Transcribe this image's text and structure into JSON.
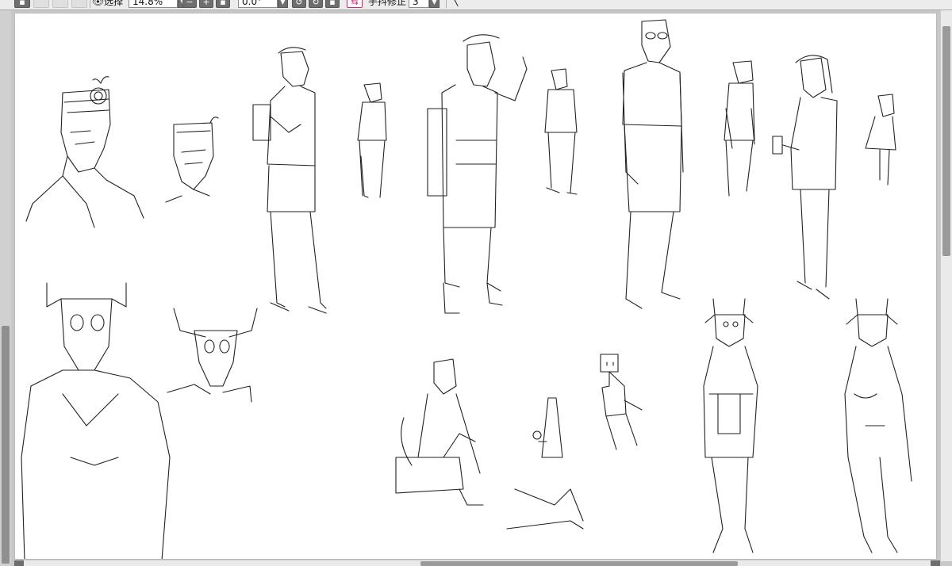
{
  "toolbar": {
    "view_mode_label": "选择",
    "zoom_value": "14.8%",
    "rotation_value": "0.0°",
    "stabilizer_label": "手抖修正",
    "stabilizer_value": "3",
    "icons": [
      "save-icon",
      "blank-icon",
      "undo-icon",
      "redo-icon",
      "eye-icon",
      "zoom-out-icon",
      "zoom-in-icon",
      "zoom-reset-icon",
      "rotate-left-icon",
      "rotate-right-icon",
      "rotate-reset-icon",
      "flip-icon",
      "line-tool-icon"
    ]
  },
  "canvas": {
    "background": "#ffffff",
    "line_color": "#222222",
    "sketches": [
      "head-with-target-pattern",
      "small-head-with-sprout",
      "standing-man-with-clipboard",
      "small-standing-figure",
      "backpacker-waving",
      "small-backpacker",
      "tall-man-with-glasses",
      "small-man-standing",
      "woman-in-coat-with-phone",
      "small-child-figure",
      "skull-headed-torso",
      "bull-skull-bust",
      "sitting-figure",
      "bonfire-sword",
      "box-head-stick-figure",
      "horned-girl-overalls",
      "horned-figure-nude-study"
    ]
  },
  "colors": {
    "toolbar_bg": "#ececec",
    "button_dark": "#6e6e6e",
    "accent_flip": "#e0207a",
    "scrollbar_thumb": "#9a9a9a"
  }
}
